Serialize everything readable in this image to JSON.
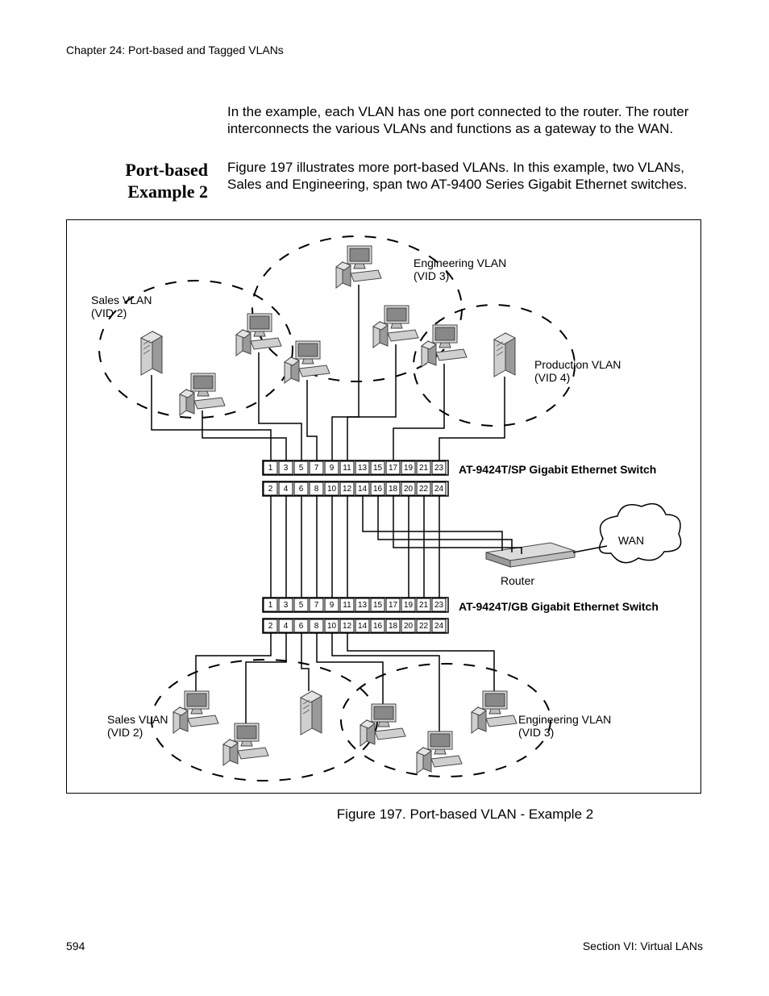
{
  "header": {
    "chapter": "Chapter 24: Port-based and Tagged VLANs"
  },
  "intro_para": "In the example, each VLAN has one port connected to the router. The router interconnects the various VLANs and functions as a gateway to the WAN.",
  "section": {
    "title_l1": "Port-based",
    "title_l2": "Example 2",
    "body": "Figure 197 illustrates more port-based VLANs. In this example, two VLANs, Sales and Engineering, span two AT-9400 Series Gigabit Ethernet switches."
  },
  "figure": {
    "caption": "Figure 197. Port-based VLAN - Example 2",
    "labels": {
      "sales_vlan_l1": "Sales VLAN",
      "sales_vlan_l2": "(VID 2)",
      "eng_vlan_l1": "Engineering VLAN",
      "eng_vlan_l2": "(VID 3)",
      "prod_vlan_l1": "Production VLAN",
      "prod_vlan_l2": "(VID 4)",
      "switch1": "AT-9424T/SP Gigabit Ethernet Switch",
      "switch2": "AT-9424T/GB Gigabit Ethernet Switch",
      "wan": "WAN",
      "router": "Router",
      "bottom_sales_l1": "Sales VLAN",
      "bottom_sales_l2": "(VID 2)",
      "bottom_eng_l1": "Engineering VLAN",
      "bottom_eng_l2": "(VID 3)"
    },
    "ports_odd": [
      "1",
      "3",
      "5",
      "7",
      "9",
      "11",
      "13",
      "15",
      "17",
      "19",
      "21",
      "23"
    ],
    "ports_even": [
      "2",
      "4",
      "6",
      "8",
      "10",
      "12",
      "14",
      "16",
      "18",
      "20",
      "22",
      "24"
    ]
  },
  "footer": {
    "page_number": "594",
    "section": "Section VI: Virtual LANs"
  }
}
